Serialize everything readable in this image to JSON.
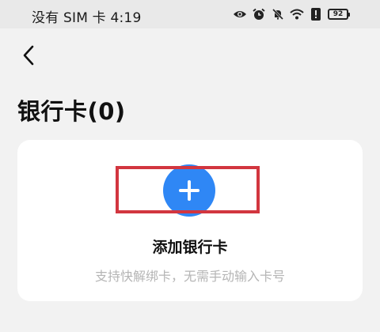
{
  "status_bar": {
    "carrier_time": "没有 SIM 卡 4:19",
    "battery": "92",
    "icons": [
      "eye-icon",
      "alarm-icon",
      "mute-icon",
      "wifi-icon",
      "alert-icon",
      "battery-icon"
    ]
  },
  "header": {
    "back_icon": "chevron-left-icon",
    "title": "银行卡(0)"
  },
  "card": {
    "add_icon": "plus-icon",
    "add_label": "添加银行卡",
    "description": "支持快解绑卡，无需手动输入卡号"
  },
  "colors": {
    "accent": "#2f87f5",
    "highlight": "#d2363f"
  }
}
